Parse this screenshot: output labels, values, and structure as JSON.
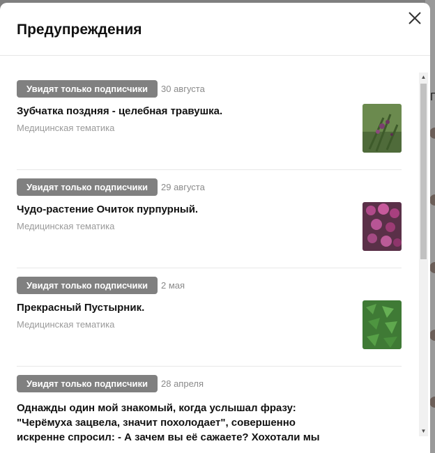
{
  "modal": {
    "title": "Предупреждения"
  },
  "posts": [
    {
      "badge": "Увидят только подписчики",
      "date": "30 августа",
      "title": "Зубчатка поздняя - целебная травушка.",
      "subtitle": "Медицинская тематика"
    },
    {
      "badge": "Увидят только подписчики",
      "date": "29 августа",
      "title": "Чудо-растение Очиток пурпурный.",
      "subtitle": "Медицинская тематика"
    },
    {
      "badge": "Увидят только подписчики",
      "date": "2 мая",
      "title": "Прекрасный Пустырник.",
      "subtitle": "Медицинская тематика"
    },
    {
      "badge": "Увидят только подписчики",
      "date": "28 апреля",
      "title": "Однажды один мой знакомый, когда услышал фразу: \"Черёмуха зацвела, значит похолодает\", совершенно искренне спросил: - А зачем вы её сажаете? Хохотали мы"
    }
  ],
  "background": {
    "letter": "П"
  },
  "icons": {
    "close": "close-icon",
    "scroll_up": "arrow-up-icon",
    "scroll_down": "arrow-down-icon"
  },
  "colors": {
    "badge": "#808080",
    "overlay": "#7f7f7f"
  }
}
